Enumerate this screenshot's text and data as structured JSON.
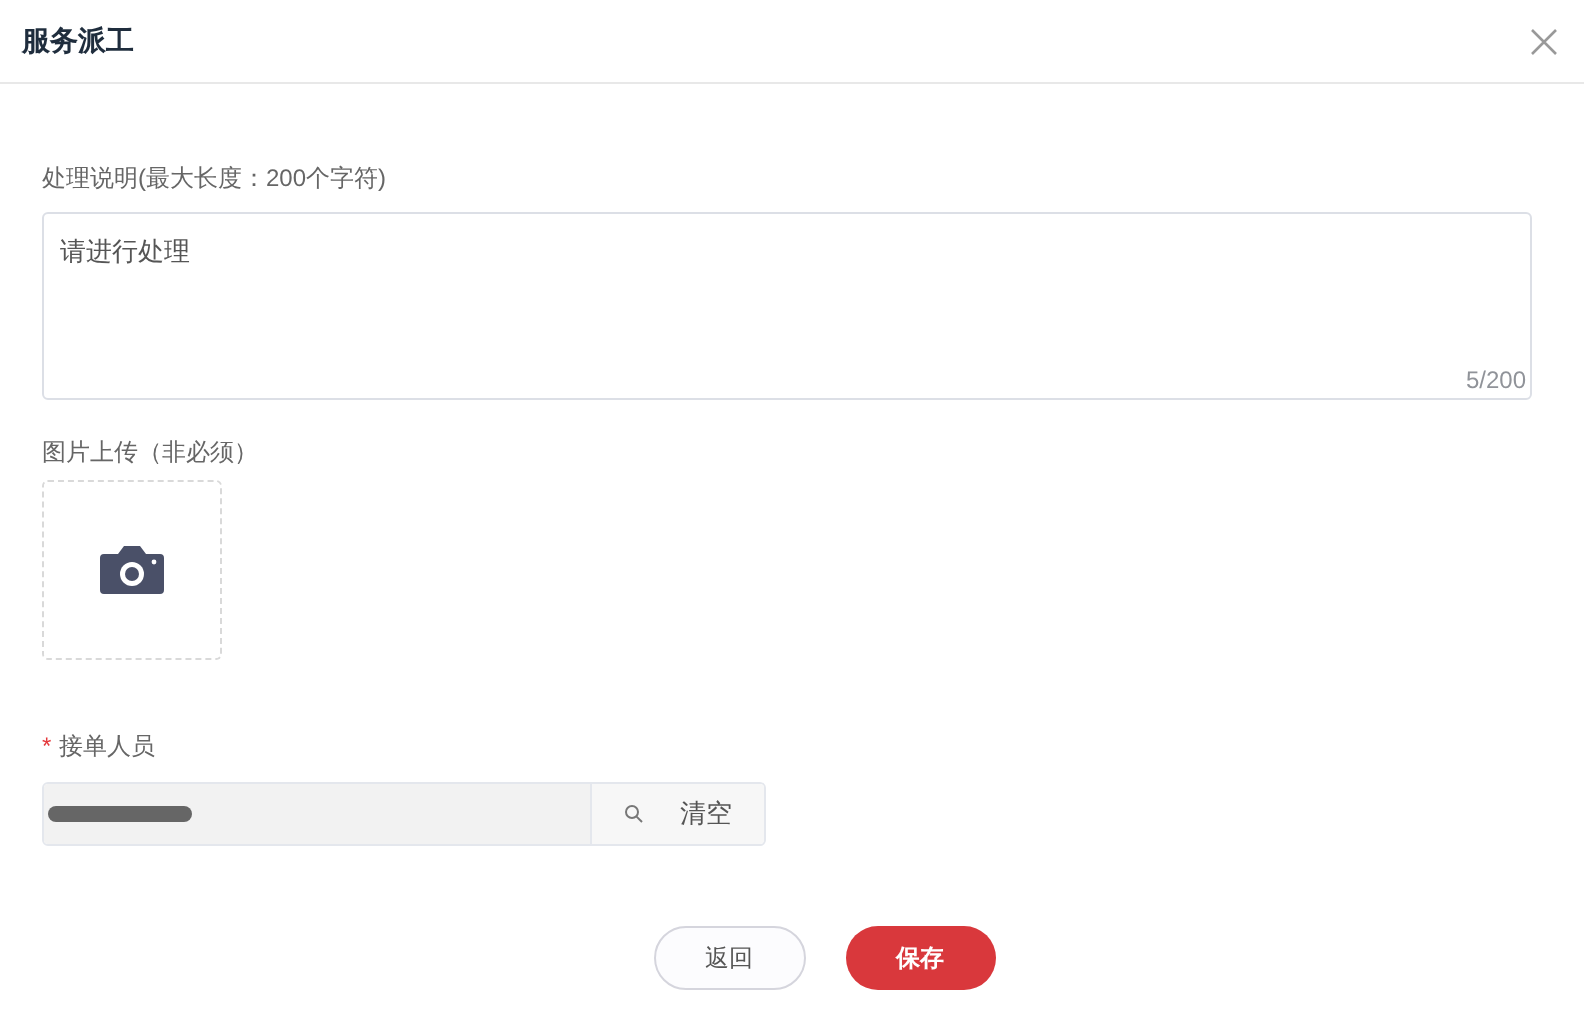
{
  "dialog": {
    "title": "服务派工"
  },
  "description": {
    "label": "处理说明(最大长度：200个字符)",
    "value": "请进行处理",
    "counter": "5/200"
  },
  "upload": {
    "label": "图片上传（非必须）"
  },
  "assignee": {
    "label": "接单人员",
    "required_mark": "*",
    "value_redacted": true,
    "clear_label": "清空"
  },
  "buttons": [
    {
      "label": "返回",
      "kind": "secondary"
    },
    {
      "label": "保存",
      "kind": "primary"
    }
  ]
}
